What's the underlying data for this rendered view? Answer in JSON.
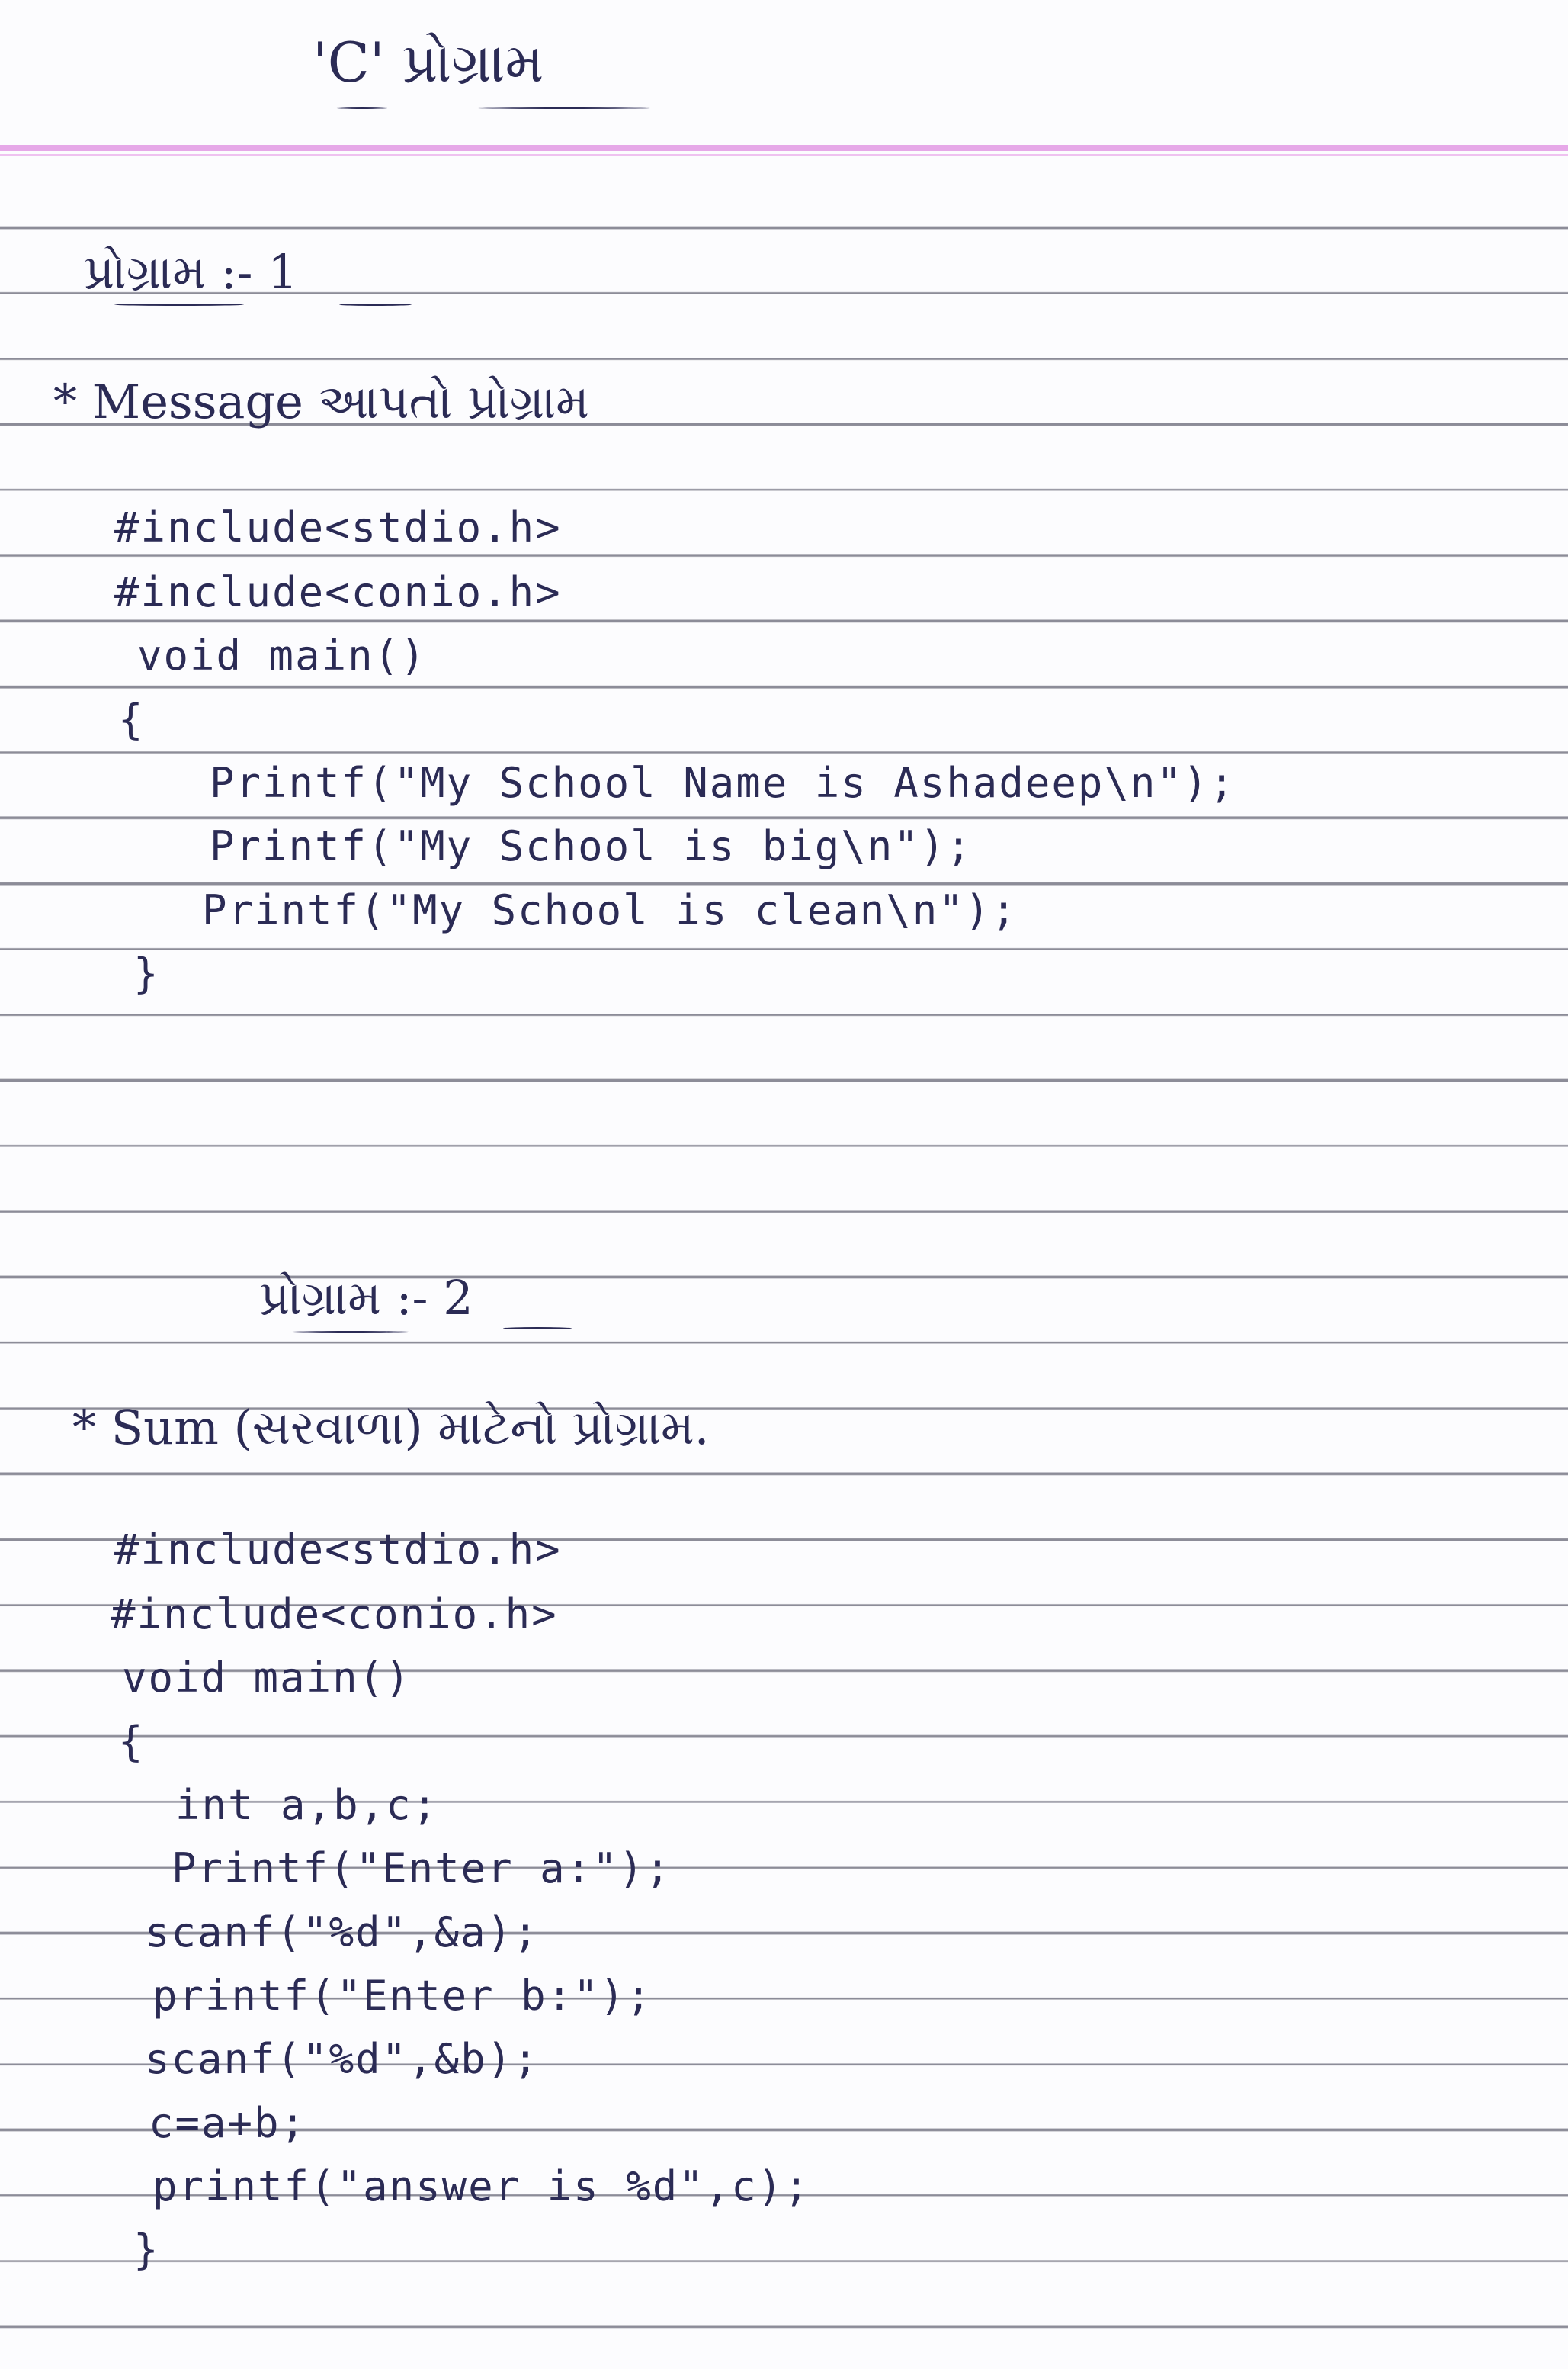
{
  "title": "'C' પ્રોગ્રામ",
  "program1": {
    "heading": "પ્રોગ્રામ :- 1",
    "description": "* Message આપતો પ્રોગ્રામ",
    "code": [
      "#include<stdio.h>",
      "#include<conio.h>",
      "void main()",
      "{",
      "Printf(\"My School Name is Ashadeep\\n\");",
      "Printf(\"My School is big\\n\");",
      "Printf(\"My School is clean\\n\");",
      "}"
    ]
  },
  "program2": {
    "heading": "પ્રોગ્રામ :- 2",
    "description": "* Sum (સરવાળા) માટેનો પ્રોગ્રામ.",
    "code": [
      "#include<stdio.h>",
      "#include<conio.h>",
      "void main()",
      "{",
      "int a,b,c;",
      "Printf(\"Enter a:\");",
      "scanf(\"%d\",&a);",
      "printf(\"Enter b:\");",
      "scanf(\"%d\",&b);",
      "c=a+b;",
      "printf(\"answer is %d\",c);",
      "}"
    ]
  }
}
